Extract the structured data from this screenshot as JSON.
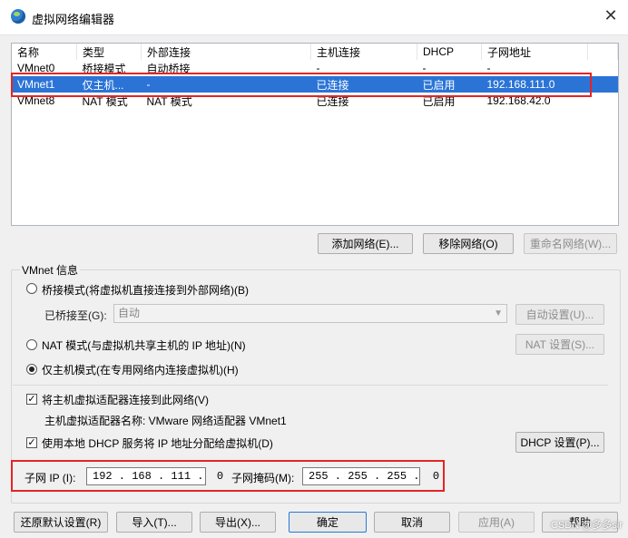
{
  "window": {
    "title": "虚拟网络编辑器",
    "close_glyph": "✕"
  },
  "table": {
    "columns": [
      "名称",
      "类型",
      "外部连接",
      "主机连接",
      "DHCP",
      "子网地址"
    ],
    "rows": [
      [
        "VMnet0",
        "桥接模式",
        "自动桥接",
        "-",
        "-",
        "-"
      ],
      [
        "VMnet1",
        "仅主机...",
        "-",
        "已连接",
        "已启用",
        "192.168.111.0"
      ],
      [
        "VMnet8",
        "NAT 模式",
        "NAT 模式",
        "已连接",
        "已启用",
        "192.168.42.0"
      ]
    ],
    "selected_index": 1
  },
  "buttons": {
    "add_network": "添加网络(E)...",
    "remove_network": "移除网络(O)",
    "rename_network": "重命名网络(W)...",
    "auto_settings": "自动设置(U)...",
    "nat_settings": "NAT 设置(S)...",
    "dhcp_settings": "DHCP 设置(P)...",
    "restore_defaults": "还原默认设置(R)",
    "import": "导入(T)...",
    "export": "导出(X)...",
    "ok": "确定",
    "cancel": "取消",
    "apply": "应用(A)",
    "help": "帮助"
  },
  "vmnet_info": {
    "label": "VMnet 信息",
    "bridge_mode": "桥接模式(将虚拟机直接连接到外部网络)(B)",
    "bridged_to_label": "已桥接至(G):",
    "bridged_to_value": "自动",
    "nat_mode": "NAT 模式(与虚拟机共享主机的 IP 地址)(N)",
    "host_only_mode": "仅主机模式(在专用网络内连接虚拟机)(H)",
    "selected_mode": "host_only",
    "connect_adapter": "将主机虚拟适配器连接到此网络(V)",
    "connect_adapter_checked": true,
    "adapter_name": "主机虚拟适配器名称: VMware 网络适配器 VMnet1",
    "use_dhcp": "使用本地 DHCP 服务将 IP 地址分配给虚拟机(D)",
    "use_dhcp_checked": true,
    "subnet_ip_label": "子网 IP (I):",
    "subnet_ip_value": "192 . 168 . 111 .  0",
    "subnet_mask_label": "子网掩码(M):",
    "subnet_mask_value": "255 . 255 . 255 .  0"
  },
  "watermark": "CSDN @多多sir",
  "colors": {
    "selection": "#2b74d6",
    "highlight_box": "#e52424"
  }
}
